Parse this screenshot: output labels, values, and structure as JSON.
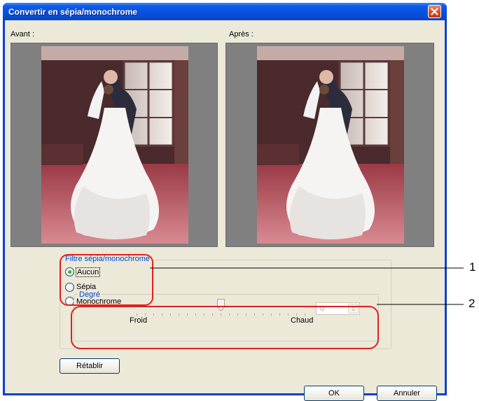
{
  "window": {
    "title": "Convertir en sépia/monochrome"
  },
  "labels": {
    "before": "Avant :",
    "after": "Après :"
  },
  "filter_group": {
    "legend": "Filtre sépia/monochrome",
    "options": [
      "Aucun",
      "Sépia",
      "Monochrome"
    ],
    "selected": "Aucun"
  },
  "degree_group": {
    "legend": "Degré",
    "min_label": "Froid",
    "max_label": "Chaud",
    "value": "0",
    "slider_fraction": 0.5,
    "enabled": false
  },
  "buttons": {
    "reset": "Rétablir",
    "ok": "OK",
    "cancel": "Annuler"
  },
  "callouts": {
    "first": "1",
    "second": "2"
  },
  "colors": {
    "title_bar": "#0550df",
    "highlight": "#e02020",
    "legend_text": "#0046d5"
  }
}
